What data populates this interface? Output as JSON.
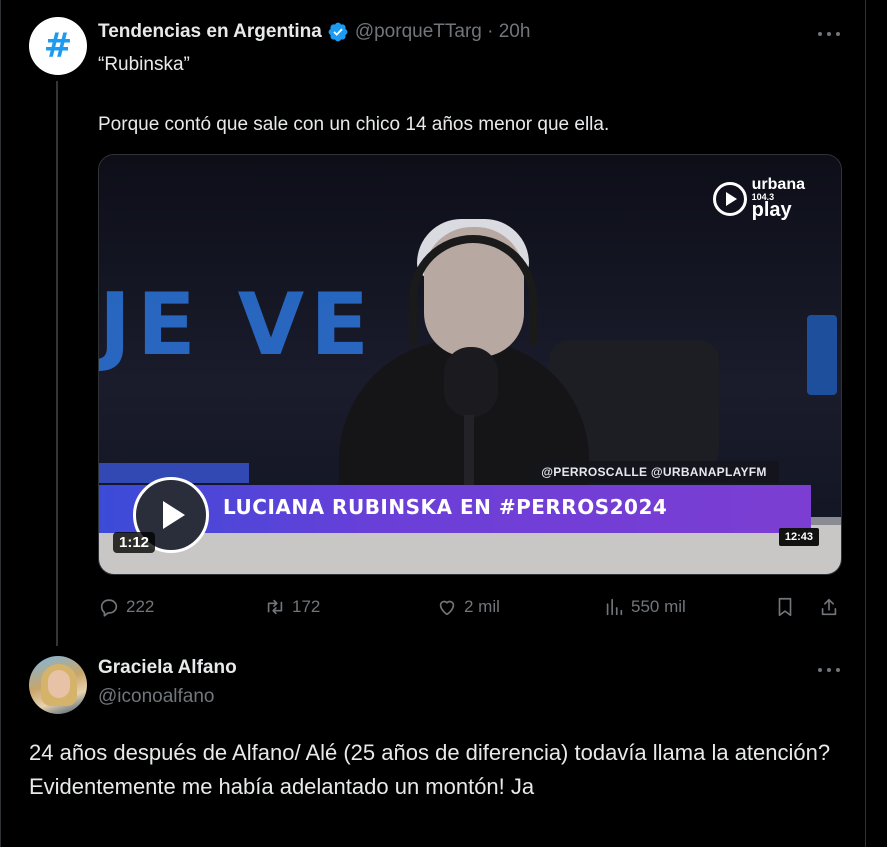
{
  "colors": {
    "background": "#000000",
    "text_primary": "#e7e9ea",
    "text_secondary": "#71767b",
    "accent": "#1d9bf0",
    "lower_third": "#6a3fd8"
  },
  "tweet1": {
    "avatar_icon": "hashtag-icon",
    "avatar_glyph": "#",
    "name": "Tendencias en Argentina",
    "verified_icon": "verified-badge-icon",
    "handle_time": "@porqueTTarg · 20h",
    "text_line1": "“Rubinska”",
    "text_line2": "Porque contó que sale con un chico 14 años menor que ella.",
    "media": {
      "wall_text": "JE VE",
      "tag_line": "@PERROSCALLE @URBANAPLAYFM",
      "lower_third": "LUCIANA RUBINSKA EN #PERROS2024",
      "brand_line1": "urbana",
      "brand_line2": "104.3",
      "brand_line3": "play",
      "duration": "1:12",
      "timestamp": "12:43"
    },
    "actions": {
      "replies": "222",
      "reposts": "172",
      "likes": "2 mil",
      "views": "550 mil"
    }
  },
  "tweet2": {
    "name": "Graciela Alfano",
    "handle": "@iconoalfano",
    "line1": "24 años después de Alfano/ Alé (25 años de diferencia) todavía llama la atención?",
    "line2": "Evidentemente me había adelantado un montón! Ja"
  }
}
